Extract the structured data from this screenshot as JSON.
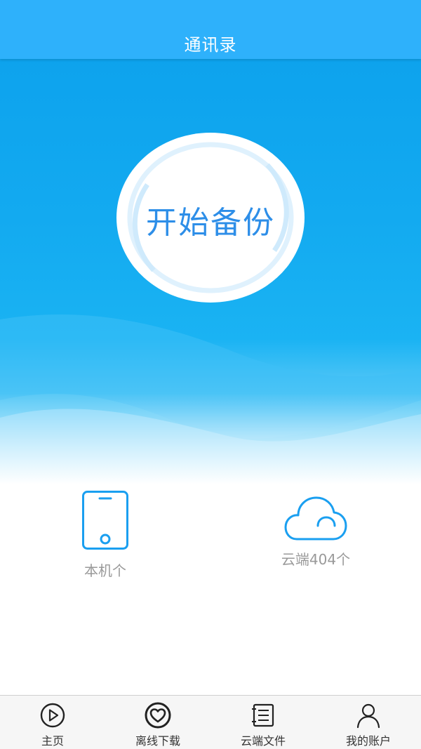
{
  "header": {
    "title": "通讯录"
  },
  "backup": {
    "label": "开始备份"
  },
  "stats": {
    "local": {
      "label": "本机",
      "count": "",
      "unit": "个"
    },
    "cloud": {
      "label": "云端",
      "count": "404",
      "unit": "个"
    }
  },
  "nav": {
    "items": [
      {
        "label": "主页",
        "icon": "play-circle-icon"
      },
      {
        "label": "离线下载",
        "icon": "heart-circle-icon"
      },
      {
        "label": "云端文件",
        "icon": "file-list-icon"
      },
      {
        "label": "我的账户",
        "icon": "user-icon"
      }
    ]
  },
  "colors": {
    "header": "#2eb1fb",
    "hero": "#13aaf0",
    "accent": "#2d8ee8",
    "icon_blue": "#1a9ff0",
    "muted_text": "#999999"
  }
}
